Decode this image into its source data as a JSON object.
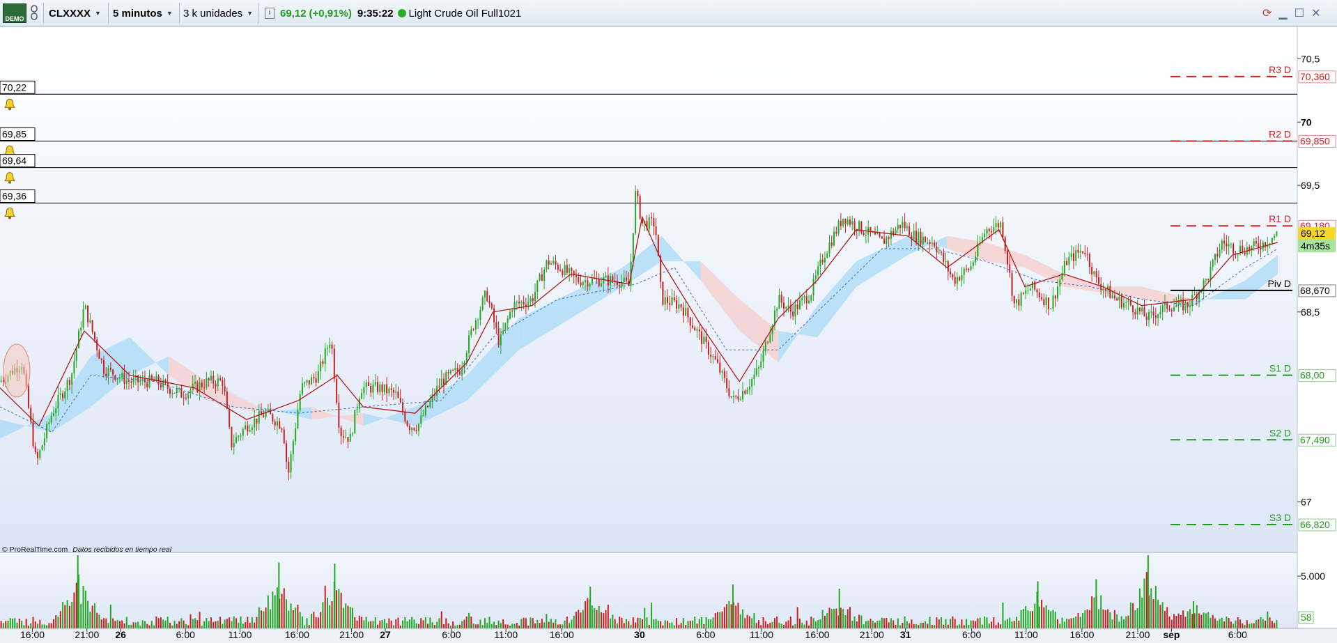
{
  "toolbar": {
    "demo_label": "DEMO",
    "symbol": "CLXXXX",
    "timeframe": "5 minutos",
    "units": "3 k unidades",
    "price": "69,12",
    "change": "(+0,91%)",
    "time": "9:35:22",
    "instrument": "Light Crude Oil Full1021"
  },
  "footer": {
    "copyright": "© ProRealTime.com",
    "status": "Datos recibidos en tiempo real"
  },
  "colors": {
    "up": "#22a822",
    "down": "#c81e1e",
    "resistance": "#d02020",
    "support": "#229a22",
    "pivot": "#000000",
    "cloud_up": "#aedcf7",
    "cloud_down": "#f6cfcf"
  },
  "chart_data": {
    "type": "candlestick",
    "y_axis": {
      "ticks": [
        {
          "value": 70.5,
          "label": "70,5"
        },
        {
          "value": 70.0,
          "label": "70"
        },
        {
          "value": 69.5,
          "label": "69,5"
        },
        {
          "value": 68.5,
          "label": "68,5"
        },
        {
          "value": 67.0,
          "label": "67"
        }
      ],
      "ylim": [
        66.6,
        70.75
      ]
    },
    "x_axis": {
      "ticks": [
        {
          "t": 0.025,
          "label": "16:00"
        },
        {
          "t": 0.067,
          "label": "21:00"
        },
        {
          "t": 0.093,
          "label": "26"
        },
        {
          "t": 0.143,
          "label": "6:00"
        },
        {
          "t": 0.185,
          "label": "11:00"
        },
        {
          "t": 0.229,
          "label": "16:00"
        },
        {
          "t": 0.271,
          "label": "21:00"
        },
        {
          "t": 0.297,
          "label": "27"
        },
        {
          "t": 0.348,
          "label": "6:00"
        },
        {
          "t": 0.39,
          "label": "11:00"
        },
        {
          "t": 0.433,
          "label": "16:00"
        },
        {
          "t": 0.493,
          "label": "30"
        },
        {
          "t": 0.544,
          "label": "6:00"
        },
        {
          "t": 0.587,
          "label": "11:00"
        },
        {
          "t": 0.63,
          "label": "16:00"
        },
        {
          "t": 0.672,
          "label": "21:00"
        },
        {
          "t": 0.698,
          "label": "31"
        },
        {
          "t": 0.749,
          "label": "6:00"
        },
        {
          "t": 0.791,
          "label": "11:00"
        },
        {
          "t": 0.834,
          "label": "16:00"
        },
        {
          "t": 0.877,
          "label": "21:00"
        },
        {
          "t": 0.903,
          "label": "sep"
        },
        {
          "t": 0.954,
          "label": "6:00"
        }
      ]
    },
    "price_path": [
      [
        0.0,
        67.95
      ],
      [
        0.017,
        68.1
      ],
      [
        0.028,
        67.3
      ],
      [
        0.04,
        67.7
      ],
      [
        0.055,
        68.0
      ],
      [
        0.065,
        68.55
      ],
      [
        0.08,
        68.05
      ],
      [
        0.1,
        67.95
      ],
      [
        0.12,
        67.95
      ],
      [
        0.14,
        67.85
      ],
      [
        0.16,
        67.95
      ],
      [
        0.172,
        67.95
      ],
      [
        0.178,
        67.45
      ],
      [
        0.19,
        67.6
      ],
      [
        0.205,
        67.7
      ],
      [
        0.218,
        67.6
      ],
      [
        0.222,
        67.2
      ],
      [
        0.232,
        67.9
      ],
      [
        0.245,
        68.0
      ],
      [
        0.255,
        68.3
      ],
      [
        0.262,
        67.55
      ],
      [
        0.27,
        67.5
      ],
      [
        0.278,
        67.9
      ],
      [
        0.292,
        67.9
      ],
      [
        0.305,
        67.85
      ],
      [
        0.315,
        67.6
      ],
      [
        0.322,
        67.6
      ],
      [
        0.34,
        67.95
      ],
      [
        0.355,
        68.05
      ],
      [
        0.365,
        68.4
      ],
      [
        0.375,
        68.65
      ],
      [
        0.385,
        68.25
      ],
      [
        0.395,
        68.55
      ],
      [
        0.41,
        68.6
      ],
      [
        0.422,
        68.9
      ],
      [
        0.432,
        68.85
      ],
      [
        0.445,
        68.75
      ],
      [
        0.46,
        68.75
      ],
      [
        0.478,
        68.75
      ],
      [
        0.485,
        68.7
      ],
      [
        0.49,
        69.45
      ],
      [
        0.495,
        69.2
      ],
      [
        0.505,
        69.2
      ],
      [
        0.51,
        68.6
      ],
      [
        0.525,
        68.55
      ],
      [
        0.54,
        68.3
      ],
      [
        0.552,
        68.1
      ],
      [
        0.565,
        67.8
      ],
      [
        0.575,
        67.9
      ],
      [
        0.585,
        68.05
      ],
      [
        0.6,
        68.6
      ],
      [
        0.61,
        68.5
      ],
      [
        0.625,
        68.65
      ],
      [
        0.635,
        68.95
      ],
      [
        0.65,
        69.25
      ],
      [
        0.665,
        69.15
      ],
      [
        0.68,
        69.05
      ],
      [
        0.695,
        69.2
      ],
      [
        0.705,
        69.1
      ],
      [
        0.72,
        69.05
      ],
      [
        0.735,
        68.75
      ],
      [
        0.748,
        68.85
      ],
      [
        0.76,
        69.15
      ],
      [
        0.772,
        69.2
      ],
      [
        0.782,
        68.55
      ],
      [
        0.795,
        68.7
      ],
      [
        0.81,
        68.55
      ],
      [
        0.822,
        68.9
      ],
      [
        0.836,
        69.0
      ],
      [
        0.845,
        68.75
      ],
      [
        0.86,
        68.6
      ],
      [
        0.872,
        68.55
      ],
      [
        0.885,
        68.45
      ],
      [
        0.9,
        68.55
      ],
      [
        0.915,
        68.55
      ],
      [
        0.93,
        68.75
      ],
      [
        0.942,
        69.05
      ],
      [
        0.952,
        69.0
      ],
      [
        0.964,
        69.0
      ],
      [
        0.975,
        69.05
      ],
      [
        0.985,
        69.12
      ]
    ],
    "moving_average_1": [
      [
        0.0,
        67.9
      ],
      [
        0.03,
        67.6
      ],
      [
        0.065,
        68.35
      ],
      [
        0.1,
        68.0
      ],
      [
        0.15,
        67.9
      ],
      [
        0.19,
        67.65
      ],
      [
        0.23,
        67.8
      ],
      [
        0.26,
        68.0
      ],
      [
        0.28,
        67.75
      ],
      [
        0.32,
        67.7
      ],
      [
        0.36,
        68.1
      ],
      [
        0.38,
        68.5
      ],
      [
        0.41,
        68.55
      ],
      [
        0.44,
        68.8
      ],
      [
        0.485,
        68.72
      ],
      [
        0.495,
        69.25
      ],
      [
        0.51,
        68.9
      ],
      [
        0.54,
        68.4
      ],
      [
        0.57,
        67.95
      ],
      [
        0.6,
        68.45
      ],
      [
        0.63,
        68.75
      ],
      [
        0.66,
        69.15
      ],
      [
        0.7,
        69.1
      ],
      [
        0.73,
        68.85
      ],
      [
        0.77,
        69.15
      ],
      [
        0.79,
        68.7
      ],
      [
        0.82,
        68.8
      ],
      [
        0.85,
        68.7
      ],
      [
        0.88,
        68.55
      ],
      [
        0.92,
        68.6
      ],
      [
        0.95,
        68.95
      ],
      [
        0.985,
        69.05
      ]
    ],
    "moving_average_2": [
      [
        0.0,
        67.75
      ],
      [
        0.04,
        67.55
      ],
      [
        0.07,
        68.0
      ],
      [
        0.12,
        67.95
      ],
      [
        0.18,
        67.75
      ],
      [
        0.23,
        67.7
      ],
      [
        0.28,
        67.75
      ],
      [
        0.34,
        67.8
      ],
      [
        0.38,
        68.3
      ],
      [
        0.43,
        68.6
      ],
      [
        0.49,
        68.72
      ],
      [
        0.52,
        68.85
      ],
      [
        0.56,
        68.2
      ],
      [
        0.6,
        68.2
      ],
      [
        0.64,
        68.6
      ],
      [
        0.68,
        69.0
      ],
      [
        0.72,
        69.0
      ],
      [
        0.76,
        68.9
      ],
      [
        0.8,
        68.75
      ],
      [
        0.84,
        68.7
      ],
      [
        0.88,
        68.6
      ],
      [
        0.92,
        68.55
      ],
      [
        0.96,
        68.85
      ],
      [
        0.985,
        69.0
      ]
    ],
    "ichimoku_cloud": [
      [
        0.0,
        67.5,
        67.65
      ],
      [
        0.04,
        67.7,
        67.55
      ],
      [
        0.07,
        68.15,
        67.75
      ],
      [
        0.1,
        68.3,
        68.0
      ],
      [
        0.13,
        68.0,
        68.15
      ],
      [
        0.16,
        67.8,
        67.95
      ],
      [
        0.2,
        67.7,
        67.75
      ],
      [
        0.24,
        67.75,
        67.65
      ],
      [
        0.28,
        67.6,
        67.7
      ],
      [
        0.32,
        67.75,
        67.6
      ],
      [
        0.36,
        68.0,
        67.8
      ],
      [
        0.4,
        68.45,
        68.2
      ],
      [
        0.44,
        68.65,
        68.45
      ],
      [
        0.48,
        68.85,
        68.7
      ],
      [
        0.51,
        69.1,
        68.9
      ],
      [
        0.54,
        68.75,
        68.9
      ],
      [
        0.57,
        68.35,
        68.6
      ],
      [
        0.6,
        68.1,
        68.35
      ],
      [
        0.63,
        68.55,
        68.3
      ],
      [
        0.66,
        68.9,
        68.7
      ],
      [
        0.7,
        69.1,
        68.95
      ],
      [
        0.73,
        69.0,
        69.1
      ],
      [
        0.76,
        68.9,
        69.05
      ],
      [
        0.79,
        68.85,
        68.95
      ],
      [
        0.82,
        68.7,
        68.8
      ],
      [
        0.85,
        68.65,
        68.7
      ],
      [
        0.88,
        68.6,
        68.7
      ],
      [
        0.92,
        68.55,
        68.6
      ],
      [
        0.96,
        68.75,
        68.6
      ],
      [
        0.985,
        68.95,
        68.8
      ]
    ],
    "alert_lines": [
      {
        "value": 70.22,
        "label": "70,22"
      },
      {
        "value": 69.85,
        "label": "69,85"
      },
      {
        "value": 69.64,
        "label": "69,64"
      },
      {
        "value": 69.36,
        "label": "69,36"
      }
    ],
    "pivot_levels": [
      {
        "name": "R3 D",
        "value": 70.36,
        "label": "70,360",
        "kind": "resistance"
      },
      {
        "name": "R2 D",
        "value": 69.85,
        "label": "69,850",
        "kind": "resistance"
      },
      {
        "name": "R1 D",
        "value": 69.18,
        "label": "69,180",
        "kind": "resistance"
      },
      {
        "name": "Piv D",
        "value": 68.67,
        "label": "68,670",
        "kind": "pivot"
      },
      {
        "name": "S1 D",
        "value": 68.0,
        "label": "68,00",
        "kind": "support"
      },
      {
        "name": "S2 D",
        "value": 67.49,
        "label": "67,490",
        "kind": "support"
      },
      {
        "name": "S3 D",
        "value": 66.82,
        "label": "66,820",
        "kind": "support"
      }
    ],
    "current_price": {
      "value": 69.12,
      "label": "69,12"
    },
    "countdown": "4m35s",
    "volume": {
      "ticks": [
        {
          "value": 5000,
          "label": "5.000"
        }
      ],
      "ylim": [
        0,
        7200
      ],
      "current_label": "58",
      "spikes": [
        [
          0.06,
          7000
        ],
        [
          0.258,
          6200
        ],
        [
          0.215,
          6300
        ],
        [
          0.455,
          4000
        ],
        [
          0.565,
          4200
        ],
        [
          0.647,
          3800
        ],
        [
          0.8,
          4500
        ],
        [
          0.845,
          4700
        ],
        [
          0.885,
          7000
        ],
        [
          0.92,
          2600
        ]
      ]
    }
  }
}
